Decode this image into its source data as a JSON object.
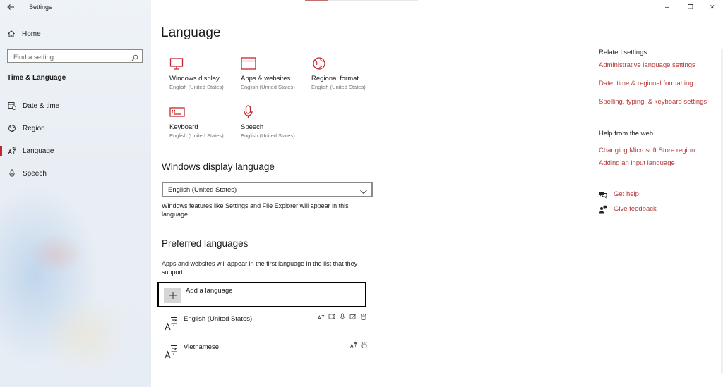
{
  "window": {
    "title": "Settings",
    "minimize": "–",
    "restore": "❐",
    "close": "✕"
  },
  "sidebar": {
    "home_label": "Home",
    "search_placeholder": "Find a setting",
    "section_title": "Time & Language",
    "items": [
      {
        "label": "Date & time"
      },
      {
        "label": "Region"
      },
      {
        "label": "Language",
        "selected": true
      },
      {
        "label": "Speech"
      }
    ]
  },
  "main": {
    "title": "Language",
    "tiles": [
      {
        "label": "Windows display",
        "sub": "English (United States)",
        "icon": "monitor-icon"
      },
      {
        "label": "Apps & websites",
        "sub": "English (United States)",
        "icon": "window-icon"
      },
      {
        "label": "Regional format",
        "sub": "English (United States)",
        "icon": "globe-icon"
      },
      {
        "label": "Keyboard",
        "sub": "English (United States)",
        "icon": "keyboard-icon"
      },
      {
        "label": "Speech",
        "sub": "English (United States)",
        "icon": "microphone-icon"
      }
    ],
    "display_language": {
      "heading": "Windows display language",
      "selected": "English (United States)",
      "description_line1": "Windows features like Settings and File Explorer will appear in this",
      "description_line2": "language."
    },
    "preferred": {
      "heading": "Preferred languages",
      "description_line1": "Apps and websites will appear in the first language in the list that they",
      "description_line2": "support.",
      "add_label": "Add a language",
      "languages": [
        {
          "name": "English (United States)"
        },
        {
          "name": "Vietnamese"
        }
      ]
    }
  },
  "related": {
    "title": "Related settings",
    "links": [
      "Administrative language settings",
      "Date, time & regional formatting",
      "Spelling, typing, & keyboard settings"
    ],
    "help_title": "Help from the web",
    "help_links": [
      "Changing Microsoft Store region",
      "Adding an input language"
    ],
    "get_help": "Get help",
    "give_feedback": "Give feedback"
  },
  "colors": {
    "accent": "#c4262e",
    "link": "#b53a3a"
  }
}
